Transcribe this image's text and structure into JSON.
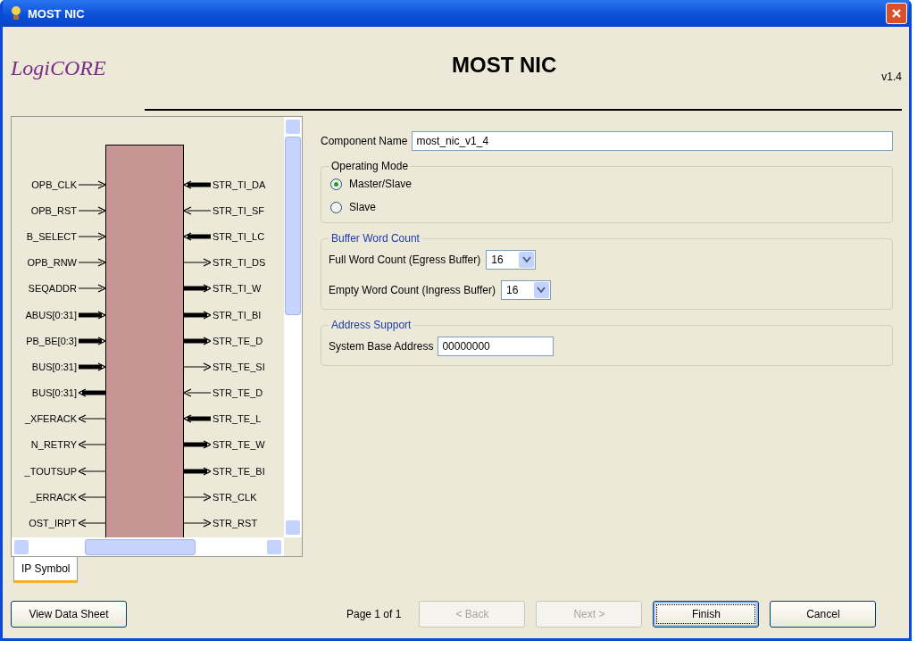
{
  "window": {
    "title": "MOST NIC"
  },
  "header": {
    "logo": "LogiCORE",
    "title": "MOST NIC",
    "version": "v1.4"
  },
  "symbol": {
    "left_pins": [
      {
        "label": "OPB_CLK",
        "kind": "input",
        "bus": false
      },
      {
        "label": "OPB_RST",
        "kind": "input",
        "bus": false
      },
      {
        "label": "B_SELECT",
        "kind": "input",
        "bus": false
      },
      {
        "label": "OPB_RNW",
        "kind": "input",
        "bus": false
      },
      {
        "label": "SEQADDR",
        "kind": "input",
        "bus": false
      },
      {
        "label": "ABUS[0:31]",
        "kind": "input",
        "bus": true
      },
      {
        "label": "PB_BE[0:3]",
        "kind": "input",
        "bus": true
      },
      {
        "label": "BUS[0:31]",
        "kind": "input",
        "bus": true
      },
      {
        "label": "BUS[0:31]",
        "kind": "output",
        "bus": true
      },
      {
        "label": "_XFERACK",
        "kind": "output",
        "bus": false
      },
      {
        "label": "N_RETRY",
        "kind": "output",
        "bus": false
      },
      {
        "label": "_TOUTSUP",
        "kind": "output",
        "bus": false
      },
      {
        "label": "_ERRACK",
        "kind": "output",
        "bus": false
      },
      {
        "label": "OST_IRPT",
        "kind": "output",
        "bus": false
      }
    ],
    "right_pins": [
      {
        "label": "STR_TI_DA",
        "kind": "input",
        "bus": true
      },
      {
        "label": "STR_TI_SF",
        "kind": "input",
        "bus": false
      },
      {
        "label": "STR_TI_LC",
        "kind": "input",
        "bus": true
      },
      {
        "label": "STR_TI_DS",
        "kind": "output",
        "bus": false
      },
      {
        "label": "STR_TI_W",
        "kind": "output",
        "bus": true
      },
      {
        "label": "STR_TI_BI",
        "kind": "output",
        "bus": true
      },
      {
        "label": "STR_TE_D",
        "kind": "output",
        "bus": true
      },
      {
        "label": "STR_TE_SI",
        "kind": "output",
        "bus": false
      },
      {
        "label": "STR_TE_D",
        "kind": "input",
        "bus": false
      },
      {
        "label": "STR_TE_L",
        "kind": "input",
        "bus": true
      },
      {
        "label": "STR_TE_W",
        "kind": "output",
        "bus": true
      },
      {
        "label": "STR_TE_BI",
        "kind": "output",
        "bus": true
      },
      {
        "label": "STR_CLK",
        "kind": "output",
        "bus": false
      },
      {
        "label": "STR_RST",
        "kind": "output",
        "bus": false
      }
    ]
  },
  "tabs": [
    {
      "label": "IP Symbol",
      "selected": true
    }
  ],
  "component_name": {
    "label": "Component Name",
    "value": "most_nic_v1_4"
  },
  "operating_mode": {
    "title": "Operating Mode",
    "options": [
      {
        "label": "Master/Slave",
        "selected": true
      },
      {
        "label": "Slave",
        "selected": false
      }
    ]
  },
  "buffer_word_count": {
    "title": "Buffer Word Count",
    "fields": [
      {
        "label": "Full Word Count (Egress Buffer)",
        "value": "16"
      },
      {
        "label": "Empty Word Count (Ingress Buffer)",
        "value": "16"
      }
    ]
  },
  "address_support": {
    "title": "Address Support",
    "label": "System Base Address",
    "value": "00000000"
  },
  "footer": {
    "datasheet_button": "View Data Sheet",
    "page": "Page 1 of 1",
    "buttons": [
      {
        "label": "< Back",
        "disabled": true,
        "focused": false
      },
      {
        "label": "Next >",
        "disabled": true,
        "focused": false
      },
      {
        "label": "Finish",
        "disabled": false,
        "focused": true
      },
      {
        "label": "Cancel",
        "disabled": false,
        "focused": false
      }
    ]
  }
}
